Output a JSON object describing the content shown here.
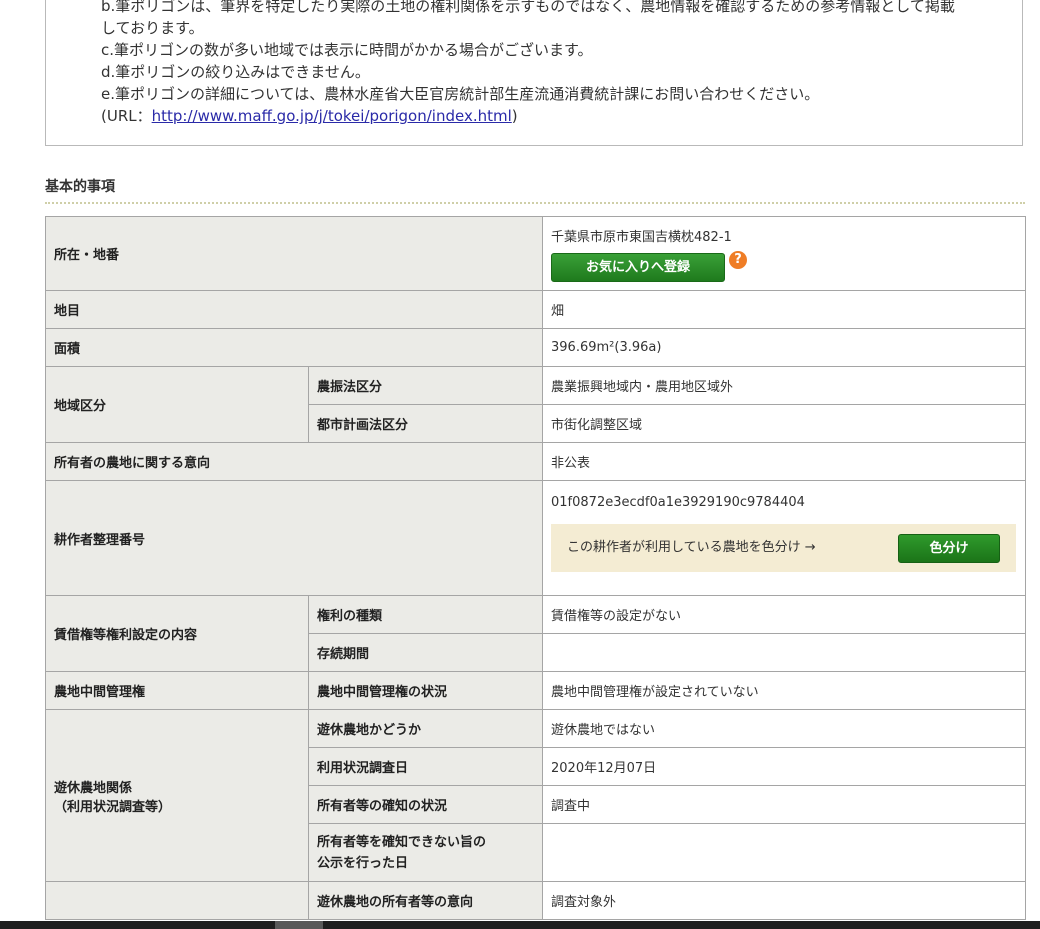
{
  "notice": {
    "lines": [
      "b.筆ポリゴンは、筆界を特定したり実際の土地の権利関係を示すものではなく、農地情報を確認するための参考情報として掲載",
      "しております。",
      "c.筆ポリゴンの数が多い地域では表示に時間がかかる場合がございます。",
      "d.筆ポリゴンの絞り込みはできません。",
      "e.筆ポリゴンの詳細については、農林水産省大臣官房統計部生産流通消費統計課にお問い合わせください。"
    ],
    "url_prefix": "(URL：",
    "url_text": "http://www.maff.go.jp/j/tokei/porigon/index.html",
    "url_suffix": ")"
  },
  "section_title": "基本的事項",
  "rows": {
    "location": {
      "label": "所在・地番",
      "value": "千葉県市原市東国吉横枕482-1",
      "fav_button": "お気に入りへ登録",
      "help_icon": "?"
    },
    "land_category": {
      "label": "地目",
      "value": "畑"
    },
    "area": {
      "label": "面積",
      "value": "396.69m²(3.96a)"
    },
    "zoning": {
      "label": "地域区分",
      "sub1_label": "農振法区分",
      "sub1_value": "農業振興地域内・農用地区域外",
      "sub2_label": "都市計画法区分",
      "sub2_value": "市街化調整区域"
    },
    "owner_intent": {
      "label": "所有者の農地に関する意向",
      "value": "非公表"
    },
    "cultivator": {
      "label": "耕作者整理番号",
      "value": "01f0872e3ecdf0a1e3929190c9784404",
      "color_text": "この耕作者が利用している農地を色分け →",
      "color_button": "色分け"
    },
    "lease": {
      "label": "賃借権等権利設定の内容",
      "sub1_label": "権利の種類",
      "sub1_value": "賃借権等の設定がない",
      "sub2_label": "存続期間",
      "sub2_value": ""
    },
    "intermediary": {
      "label": "農地中間管理権",
      "sub1_label": "農地中間管理権の状況",
      "sub1_value": "農地中間管理権が設定されていない"
    },
    "idle": {
      "label_line1": "遊休農地関係",
      "label_line2": "（利用状況調査等）",
      "sub1_label": "遊休農地かどうか",
      "sub1_value": "遊休農地ではない",
      "sub2_label": "利用状況調査日",
      "sub2_value": "2020年12月07日",
      "sub3_label": "所有者等の確知の状況",
      "sub3_value": "調査中",
      "sub4_label_line1": "所有者等を確知できない旨の",
      "sub4_label_line2": "公示を行った日",
      "sub4_value": ""
    },
    "idle_owner": {
      "label": "",
      "sub1_label": "遊休農地の所有者等の意向",
      "sub1_value": "調査対象外"
    }
  }
}
